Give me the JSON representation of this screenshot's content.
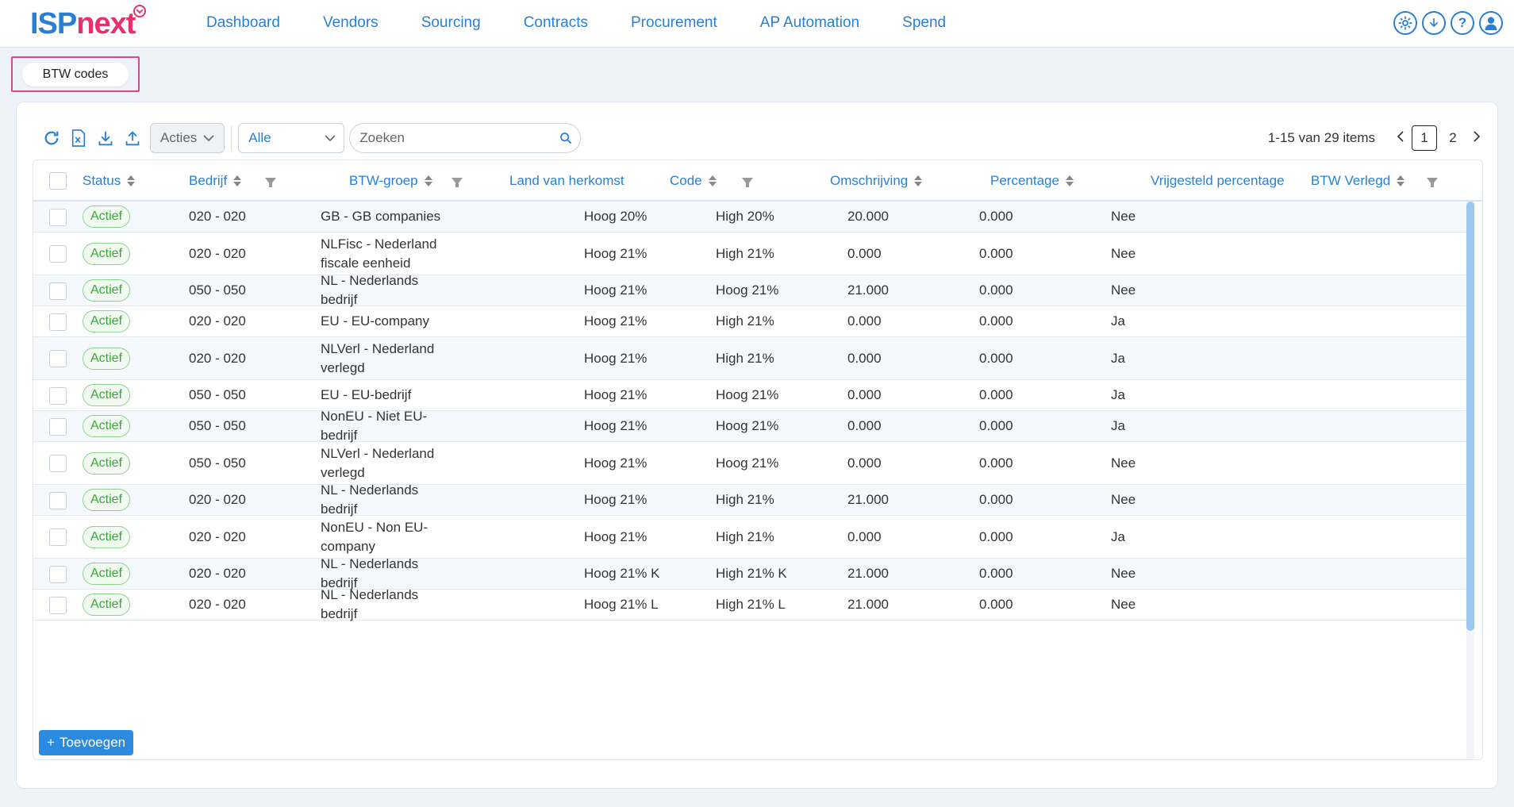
{
  "logo": {
    "part1": "ISP",
    "part2": "next"
  },
  "nav": [
    "Dashboard",
    "Vendors",
    "Sourcing",
    "Contracts",
    "Procurement",
    "AP Automation",
    "Spend"
  ],
  "tab": {
    "label": "BTW codes"
  },
  "toolbar": {
    "actions_label": "Acties",
    "filter_value": "Alle",
    "search_placeholder": "Zoeken"
  },
  "pager": {
    "info": "1-15 van 29 items",
    "page1": "1",
    "page2": "2"
  },
  "columns": {
    "status": "Status",
    "bedrijf": "Bedrijf",
    "btw_groep": "BTW-groep",
    "land": "Land van herkomst",
    "code": "Code",
    "omschrijving": "Omschrijving",
    "percentage": "Percentage",
    "vrijgesteld": "Vrijgesteld percentage",
    "verlegd": "BTW Verlegd"
  },
  "rows": [
    {
      "status": "Actief",
      "bedrijf": "020 - 020",
      "btw_groep": "GB - GB companies",
      "code": "Hoog 20%",
      "omschrijving": "High 20%",
      "percentage": "20.000",
      "vrijgesteld": "0.000",
      "verlegd": "Nee"
    },
    {
      "status": "Actief",
      "bedrijf": "020 - 020",
      "btw_groep": "NLFisc - Nederland fiscale eenheid",
      "code": "Hoog 21%",
      "omschrijving": "High 21%",
      "percentage": "0.000",
      "vrijgesteld": "0.000",
      "verlegd": "Nee"
    },
    {
      "status": "Actief",
      "bedrijf": "050 - 050",
      "btw_groep": "NL - Nederlands bedrijf",
      "code": "Hoog 21%",
      "omschrijving": "Hoog 21%",
      "percentage": "21.000",
      "vrijgesteld": "0.000",
      "verlegd": "Nee"
    },
    {
      "status": "Actief",
      "bedrijf": "020 - 020",
      "btw_groep": "EU - EU-company",
      "code": "Hoog 21%",
      "omschrijving": "High 21%",
      "percentage": "0.000",
      "vrijgesteld": "0.000",
      "verlegd": "Ja"
    },
    {
      "status": "Actief",
      "bedrijf": "020 - 020",
      "btw_groep": "NLVerl - Nederland verlegd",
      "code": "Hoog 21%",
      "omschrijving": "High 21%",
      "percentage": "0.000",
      "vrijgesteld": "0.000",
      "verlegd": "Ja"
    },
    {
      "status": "Actief",
      "bedrijf": "050 - 050",
      "btw_groep": "EU - EU-bedrijf",
      "code": "Hoog 21%",
      "omschrijving": "Hoog 21%",
      "percentage": "0.000",
      "vrijgesteld": "0.000",
      "verlegd": "Ja"
    },
    {
      "status": "Actief",
      "bedrijf": "050 - 050",
      "btw_groep": "NonEU - Niet EU-bedrijf",
      "code": "Hoog 21%",
      "omschrijving": "Hoog 21%",
      "percentage": "0.000",
      "vrijgesteld": "0.000",
      "verlegd": "Ja"
    },
    {
      "status": "Actief",
      "bedrijf": "050 - 050",
      "btw_groep": "NLVerl - Nederland verlegd",
      "code": "Hoog 21%",
      "omschrijving": "Hoog 21%",
      "percentage": "0.000",
      "vrijgesteld": "0.000",
      "verlegd": "Nee"
    },
    {
      "status": "Actief",
      "bedrijf": "020 - 020",
      "btw_groep": "NL - Nederlands bedrijf",
      "code": "Hoog 21%",
      "omschrijving": "High 21%",
      "percentage": "21.000",
      "vrijgesteld": "0.000",
      "verlegd": "Nee"
    },
    {
      "status": "Actief",
      "bedrijf": "020 - 020",
      "btw_groep": "NonEU - Non EU-company",
      "code": "Hoog 21%",
      "omschrijving": "High 21%",
      "percentage": "0.000",
      "vrijgesteld": "0.000",
      "verlegd": "Ja"
    },
    {
      "status": "Actief",
      "bedrijf": "020 - 020",
      "btw_groep": "NL - Nederlands bedrijf",
      "code": "Hoog 21% K",
      "omschrijving": "High 21% K",
      "percentage": "21.000",
      "vrijgesteld": "0.000",
      "verlegd": "Nee"
    },
    {
      "status": "Actief",
      "bedrijf": "020 - 020",
      "btw_groep": "NL - Nederlands bedrijf",
      "code": "Hoog 21% L",
      "omschrijving": "High 21% L",
      "percentage": "21.000",
      "vrijgesteld": "0.000",
      "verlegd": "Nee"
    }
  ],
  "add_button": {
    "label": "Toevoegen"
  },
  "colors": {
    "brand_blue": "#2a7fd4",
    "brand_pink": "#e8316b",
    "status_green": "#3aa63a",
    "highlight_border": "#e0468a"
  },
  "icons": [
    "settings-gear-icon",
    "download-circle-icon",
    "help-icon",
    "user-icon",
    "refresh-icon",
    "excel-export-icon",
    "download-icon",
    "upload-icon",
    "search-icon",
    "chevron-down-icon",
    "sort-icon",
    "filter-icon",
    "plus-icon"
  ]
}
